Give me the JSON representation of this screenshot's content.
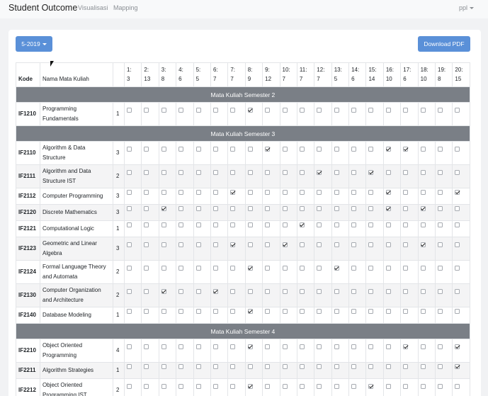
{
  "navbar": {
    "brand": "Student Outcome",
    "links": [
      "Visualisasi",
      "Mapping"
    ],
    "user": "ppl"
  },
  "toolbar": {
    "period_select": "5-2019",
    "download_label": "Download PDF"
  },
  "table": {
    "header": {
      "kode": "Kode",
      "nama": "Nama Mata Kuliah",
      "columns": [
        {
          "top": "1:",
          "bottom": "3"
        },
        {
          "top": "2:",
          "bottom": "13"
        },
        {
          "top": "3:",
          "bottom": "8"
        },
        {
          "top": "4:",
          "bottom": "6"
        },
        {
          "top": "5:",
          "bottom": "5"
        },
        {
          "top": "6:",
          "bottom": "7"
        },
        {
          "top": "7:",
          "bottom": "7"
        },
        {
          "top": "8:",
          "bottom": "9"
        },
        {
          "top": "9:",
          "bottom": "12"
        },
        {
          "top": "10:",
          "bottom": "7"
        },
        {
          "top": "11:",
          "bottom": "7"
        },
        {
          "top": "12:",
          "bottom": "7"
        },
        {
          "top": "13:",
          "bottom": "5"
        },
        {
          "top": "14:",
          "bottom": "6"
        },
        {
          "top": "15:",
          "bottom": "14"
        },
        {
          "top": "16:",
          "bottom": "10"
        },
        {
          "top": "17:",
          "bottom": "6"
        },
        {
          "top": "18:",
          "bottom": "10"
        },
        {
          "top": "19:",
          "bottom": "8"
        },
        {
          "top": "20:",
          "bottom": "15"
        }
      ]
    },
    "groups": [
      {
        "title": "Mata Kuliah Semester 2",
        "rows": [
          {
            "kode": "IF1210",
            "nama": [
              "Programming",
              "Fundamentals"
            ],
            "sks": "1",
            "checked": [
              8
            ]
          }
        ]
      },
      {
        "title": "Mata Kuliah Semester 3",
        "rows": [
          {
            "kode": "IF2110",
            "nama": [
              "Algorithm & Data",
              "Structure"
            ],
            "sks": "3",
            "checked": [
              9,
              16,
              17
            ]
          },
          {
            "kode": "IF2111",
            "nama": [
              "Algorithm and Data",
              "Structure IST"
            ],
            "sks": "2",
            "checked": [
              12,
              15
            ]
          },
          {
            "kode": "IF2112",
            "nama": [
              "Computer Programming"
            ],
            "sks": "3",
            "checked": [
              7,
              16,
              20
            ]
          },
          {
            "kode": "IF2120",
            "nama": [
              "Discrete Mathematics"
            ],
            "sks": "3",
            "checked": [
              3,
              16,
              18
            ]
          },
          {
            "kode": "IF2121",
            "nama": [
              "Computational Logic"
            ],
            "sks": "1",
            "checked": [
              11
            ]
          },
          {
            "kode": "IF2123",
            "nama": [
              "Geometric and Linear",
              "Algebra"
            ],
            "sks": "3",
            "checked": [
              7,
              10,
              18
            ]
          },
          {
            "kode": "IF2124",
            "nama": [
              "Formal Language Theory",
              "and Automata"
            ],
            "sks": "2",
            "checked": [
              8,
              13
            ]
          },
          {
            "kode": "IF2130",
            "nama": [
              "Computer Organization",
              "and Architecture"
            ],
            "sks": "2",
            "checked": [
              3,
              6
            ]
          },
          {
            "kode": "IF2140",
            "nama": [
              "Database Modeling"
            ],
            "sks": "1",
            "checked": [
              8
            ]
          }
        ]
      },
      {
        "title": "Mata Kuliah Semester 4",
        "rows": [
          {
            "kode": "IF2210",
            "nama": [
              "Object Oriented",
              "Programming"
            ],
            "sks": "4",
            "checked": [
              8,
              17,
              20
            ]
          },
          {
            "kode": "IF2211",
            "nama": [
              "Algorithm Strategies"
            ],
            "sks": "1",
            "checked": [
              20
            ]
          },
          {
            "kode": "IF2212",
            "nama": [
              "Object Oriented",
              "Programming IST"
            ],
            "sks": "2",
            "checked": [
              8,
              15
            ]
          }
        ]
      }
    ]
  }
}
